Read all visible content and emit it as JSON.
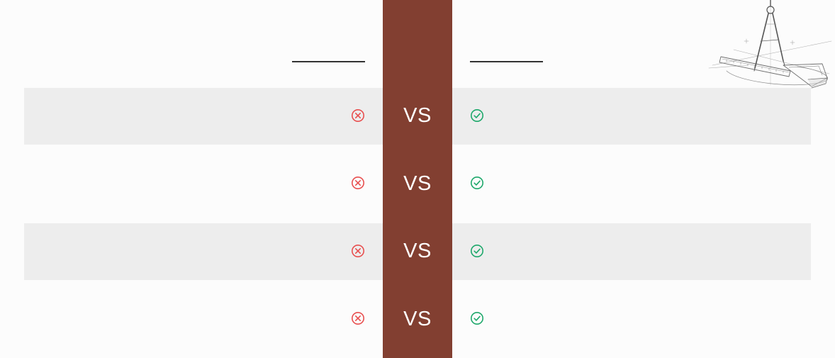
{
  "slide": {
    "rows": [
      {
        "vs_label": "VS",
        "left_status": "negative",
        "right_status": "positive",
        "shaded": true
      },
      {
        "vs_label": "VS",
        "left_status": "negative",
        "right_status": "positive",
        "shaded": false
      },
      {
        "vs_label": "VS",
        "left_status": "negative",
        "right_status": "positive",
        "shaded": true
      },
      {
        "vs_label": "VS",
        "left_status": "negative",
        "right_status": "positive",
        "shaded": false
      }
    ],
    "icons": {
      "negative": "cross-circle-icon",
      "positive": "check-circle-icon",
      "decoration": "compass-ruler-sketch"
    },
    "colors": {
      "vs_column": "#823f31",
      "vs_text": "#ffffff",
      "negative": "#e84f4f",
      "positive": "#1ea86b",
      "band": "#ededed",
      "rule": "#333333"
    }
  }
}
